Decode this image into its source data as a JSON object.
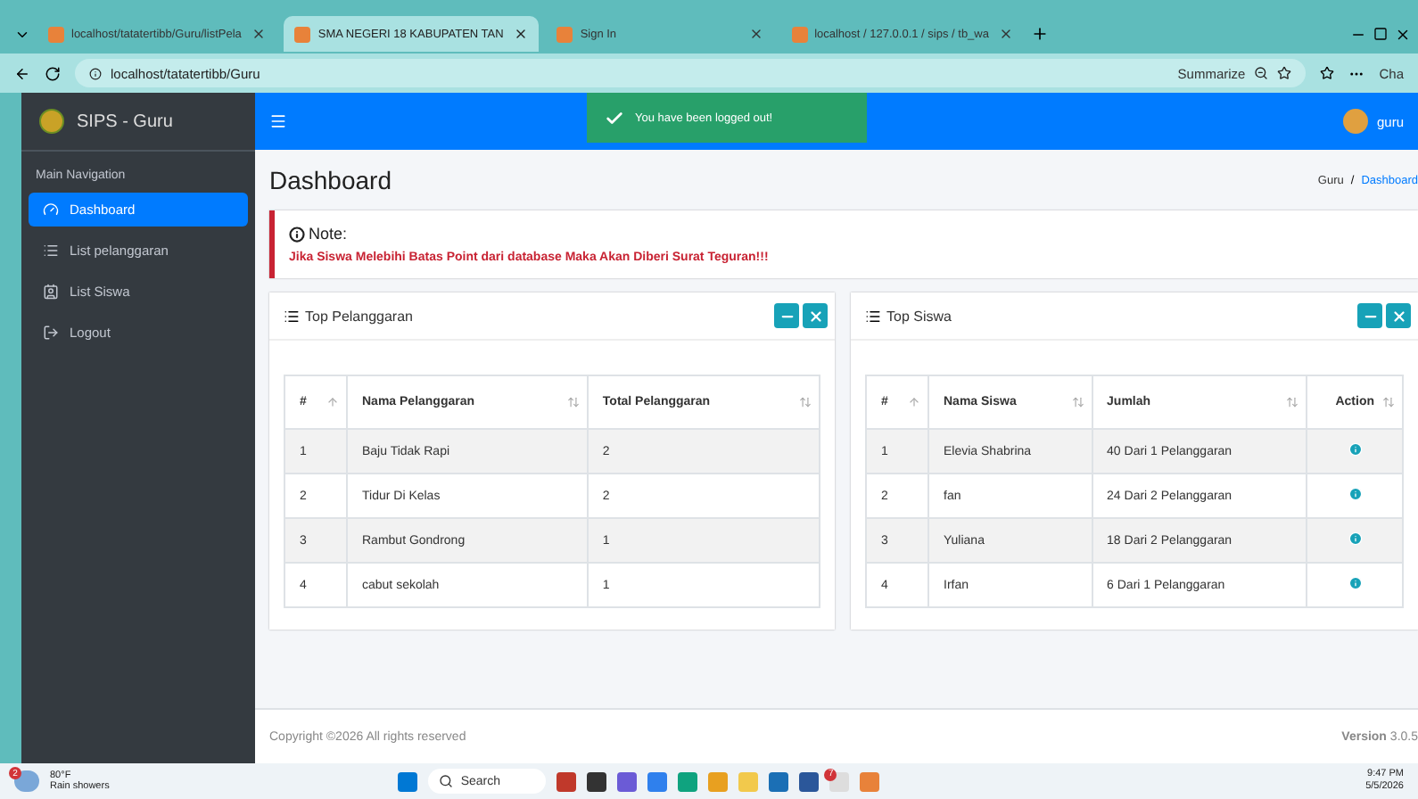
{
  "browser": {
    "tabs": [
      {
        "title": "localhost/tatatertibb/Guru/listPela",
        "selected": false
      },
      {
        "title": "SMA NEGERI 18 KABUPATEN TAN",
        "selected": true
      },
      {
        "title": "Sign In",
        "selected": false
      },
      {
        "title": "localhost / 127.0.0.1 / sips / tb_wa",
        "selected": false
      }
    ],
    "address": "localhost/tatatertibb/Guru",
    "summarize": "Summarize",
    "copilot": "Cha"
  },
  "sidebar": {
    "brand": "SIPS - Guru",
    "header": "Main Navigation",
    "items": [
      {
        "label": "Dashboard",
        "selected": true
      },
      {
        "label": "List pelanggaran",
        "selected": false
      },
      {
        "label": "List Siswa",
        "selected": false
      },
      {
        "label": "Logout",
        "selected": false
      }
    ]
  },
  "navbar": {
    "toast": "You have been logged out!",
    "user": "guru"
  },
  "page": {
    "title": "Dashboard",
    "breadcrumb": [
      "Guru",
      "Dashboard"
    ],
    "breadcrumb_separator": "/"
  },
  "note": {
    "title": "Note:",
    "text": "Jika Siswa Melebihi Batas Point dari database Maka Akan Diberi Surat Teguran!!!"
  },
  "cards": [
    {
      "title": "Top Pelanggaran",
      "columns": [
        "#",
        "Nama Pelanggaran",
        "Total Pelanggaran"
      ],
      "rows": [
        [
          "1",
          "Baju Tidak Rapi",
          "2"
        ],
        [
          "2",
          "Tidur Di Kelas",
          "2"
        ],
        [
          "3",
          "Rambut Gondrong",
          "1"
        ],
        [
          "4",
          "cabut sekolah",
          "1"
        ]
      ]
    },
    {
      "title": "Top Siswa",
      "columns": [
        "#",
        "Nama Siswa",
        "Jumlah",
        "Action"
      ],
      "rows": [
        [
          "1",
          "Elevia Shabrina",
          "40 Dari 1 Pelanggaran"
        ],
        [
          "2",
          "fan",
          "24 Dari 2 Pelanggaran"
        ],
        [
          "3",
          "Yuliana",
          "18 Dari 2 Pelanggaran"
        ],
        [
          "4",
          "Irfan",
          "6 Dari 1 Pelanggaran"
        ]
      ]
    }
  ],
  "footer": {
    "copyright": "Copyright ©2026 All rights reserved",
    "version_label": "Version",
    "version": "3.0.5"
  },
  "taskbar": {
    "weather_badge": "2",
    "temperature": "80°F",
    "weather": "Rain showers",
    "search": "Search",
    "notes_badge": "7",
    "time": "9:47 PM",
    "date": "5/5/2026"
  }
}
